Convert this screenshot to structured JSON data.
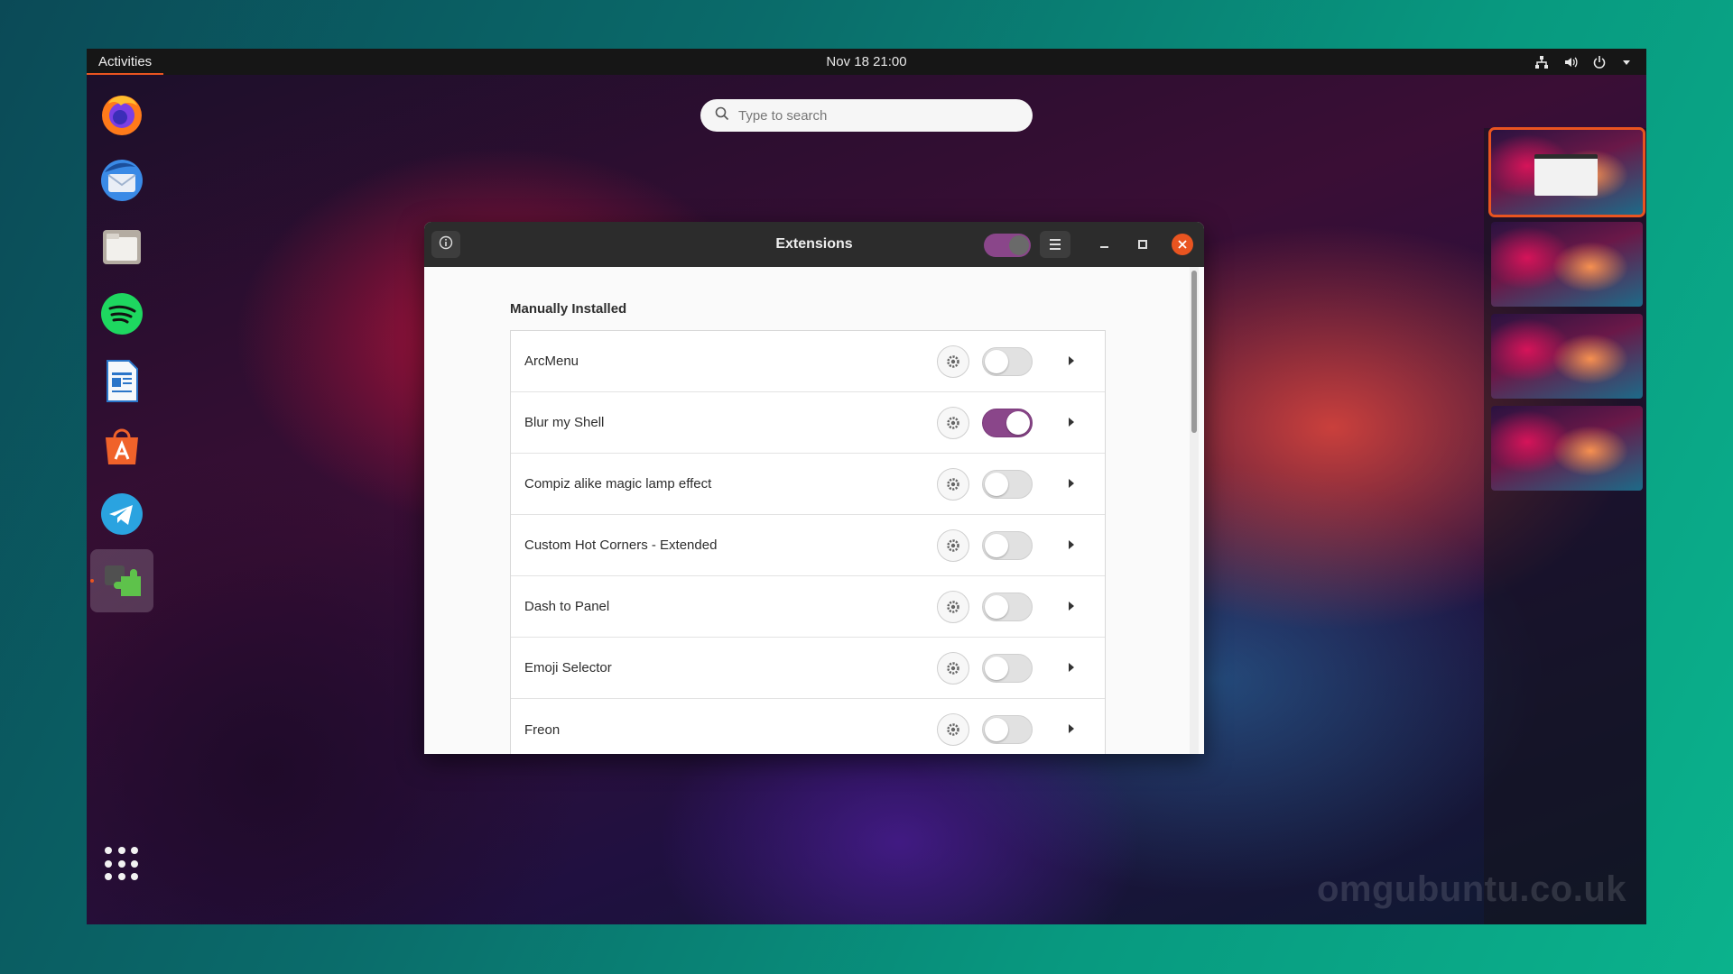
{
  "topbar": {
    "activities": "Activities",
    "clock": "Nov 18  21:00",
    "tray_icons": [
      "network-icon",
      "volume-icon",
      "power-icon",
      "menu-arrow-icon"
    ]
  },
  "dock": {
    "apps": [
      "firefox-icon",
      "thunderbird-icon",
      "files-icon",
      "spotify-icon",
      "libreoffice-writer-icon",
      "app-center-icon",
      "telegram-icon",
      "extensions-icon"
    ],
    "active_app": "extensions-icon",
    "show_apps": "show-applications-icon"
  },
  "search": {
    "placeholder": "Type to search"
  },
  "window": {
    "title": "Extensions",
    "master_toggle_on": true,
    "section_title": "Manually Installed",
    "extensions": [
      {
        "name": "ArcMenu",
        "enabled": false
      },
      {
        "name": "Blur my Shell",
        "enabled": true
      },
      {
        "name": "Compiz alike magic lamp effect",
        "enabled": false
      },
      {
        "name": "Custom Hot Corners - Extended",
        "enabled": false
      },
      {
        "name": "Dash to Panel",
        "enabled": false
      },
      {
        "name": "Emoji Selector",
        "enabled": false
      },
      {
        "name": "Freon",
        "enabled": false
      }
    ]
  },
  "workspaces": {
    "count": 4,
    "active_index": 0
  },
  "watermark": "omgubuntu.co.uk",
  "colors": {
    "accent": "#e95420",
    "toggle_on": "#8a468a",
    "headerbar": "#2c2c2c",
    "topbar": "#161616"
  }
}
